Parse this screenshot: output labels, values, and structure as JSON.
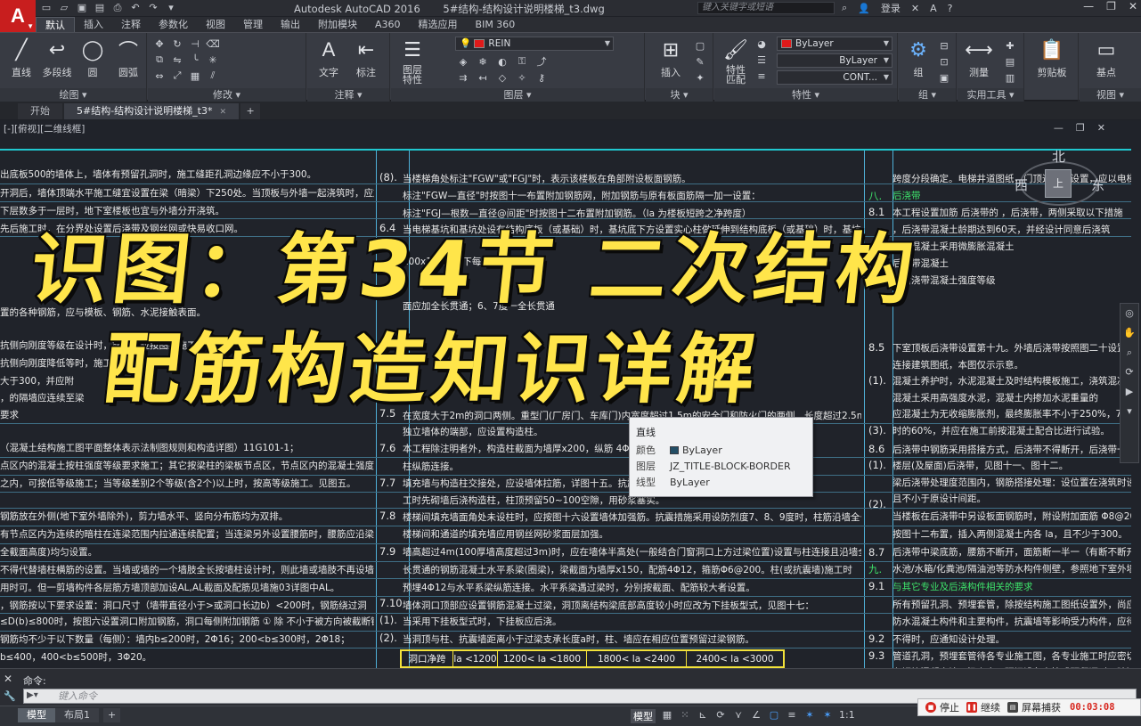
{
  "app": {
    "logo": "A",
    "product": "Autodesk AutoCAD 2016",
    "filename": "5#结构-结构设计说明楼梯_t3.dwg",
    "search_placeholder": "键入关键字或短语",
    "login": "登录"
  },
  "colors": {
    "accent": "#c81e1e",
    "headline": "#ffe54a",
    "cyan_border": "#20c7cf",
    "grid_line": "#4fb0d8",
    "green_text": "#3ee36b"
  },
  "ribbon_tabs": [
    "默认",
    "插入",
    "注释",
    "参数化",
    "视图",
    "管理",
    "输出",
    "附加模块",
    "A360",
    "精选应用",
    "BIM 360"
  ],
  "ribbon": {
    "draw": {
      "title": "绘图",
      "tools": [
        "直线",
        "多段线",
        "圆",
        "圆弧"
      ]
    },
    "modify": {
      "title": "修改"
    },
    "annotation": {
      "title": "注释",
      "tools": [
        "文字",
        "标注"
      ]
    },
    "layers": {
      "title": "图层",
      "layer_props": "图层\n特性",
      "current_layer": "REIN"
    },
    "block": {
      "title": "块",
      "insert": "插入"
    },
    "properties": {
      "title": "特性",
      "match": "特性\n匹配",
      "color": "ByLayer",
      "linetype": "ByLayer",
      "lineweight": "CONT..."
    },
    "groups": {
      "title": "组",
      "group": "组"
    },
    "utilities": {
      "title": "实用工具",
      "measure": "测量"
    },
    "clipboard": {
      "title": "剪贴板",
      "label": "剪贴板"
    },
    "view": {
      "title": "视图",
      "base": "基点"
    }
  },
  "file_tabs": [
    {
      "label": "开始",
      "active": false
    },
    {
      "label": "5#结构-结构设计说明楼梯_t3*",
      "active": true
    }
  ],
  "viewport": {
    "label": "[-][俯视][二维线框]",
    "viewcube": {
      "north": "北",
      "west": "西",
      "east": "东",
      "top": "上"
    }
  },
  "drawing": {
    "col1": [
      "出底板500的墙体上，墙体有预留孔洞时，施工缝距孔洞边缘应不小于300。",
      "开洞后，墙体顶端水平施工缝宜设置在梁（暗梁）下250处。当顶板与外墙一起浇筑时，应加强",
      "下层数多于一层时，地下室楼板也宜与外墙分开浇筑。",
      "先后施工时，在分界处设置后浇带及钢丝网或快易收口网。",
      "置的各种钢筋，应与模板、钢筋、水泥接触表面。",
      "抗侧向刚度等级在设计时，施工中应按图纸施工要求",
      "抗侧向刚度降低等时，施工时加强配筋",
      "大于300，并应附",
      "，的隔墙应连续至梁",
      "要求",
      "（混凝土结构施工图平面整体表示法制图规则和构造详图）11G101-1；",
      "点区内的混凝土按柱强度等级要求施工；其它按梁柱的梁板节点区，节点区内的混凝土强度等级",
      "之内，可按低等级施工；当等级差别2个等级(含2个)以上时，按高等级施工。见图五。",
      "钢筋放在外侧(地下室外墙除外)，剪力墙水平、竖向分布筋均为双排。",
      "有节点区内为连续的暗柱在连梁范围内拉通连续配置；当连梁另外设置腰筋时，腰筋应沿梁高(即",
      "全截面高度)均匀设置。",
      "不得代替墙柱横筋的设置。当墙或墙的一个墙肢全长按墙柱设计时，则此墙或墙肢不再设墙体",
      "用时可。但一剪墙构件各层筋方墙顶部加设AL,AL截面及配筋见墙施03详图中AL。",
      "，钢筋按以下要求设置：洞口尺寸（墙带直径小于>或洞口长边b）<200时，钢筋绕过洞",
      "≤D(b)≤800时，按图六设置洞口附加钢筋，洞口每侧附加钢筋  ① 除 不小于被方向被截断钢筋",
      "钢筋均不少于以下数量（每侧）：墙内b≤200时，2Φ16；200<b≤300时，2Φ18；",
      "b≤400，400<b≤500时，3Φ20。"
    ],
    "col2_nums": [
      "(8).",
      "6.4",
      "7.5",
      "7.6",
      "7.7",
      "7.8",
      "7.9",
      "7.10",
      "(1).",
      "(2)."
    ],
    "col2": [
      "当楼梯角处标注\"FGW\"或\"FGJ\"时，表示该楼板在角部附设板面钢筋。",
      "标注\"FGW—直径\"时按图十一布置附加钢筋网，附加钢筋与原有板面筋隔一加一设置：",
      "标注\"FGJ—根数—直径@间距\"时按图十二布置附加钢筋。（la 为楼板短跨之净跨度）",
      "当电梯基坑和基坑处设有结构底板（或基础）时，基坑底下方设置实心柱做延伸到结构底板（或基础）时，基坑",
      "100x100且住下每",
      "面应加全长贯通；6、7度一全长贯通",
      "在宽度大于2m的洞口两侧。重型门(厂房门、车库门)内宽度超过1.5m的安全门和防火门的两侧。长度超过2.5m的",
      "独立墙体的端部，应设置构造柱。",
      "本工程除注明者外，构造柱截面为墙厚x200，纵筋 4Φ10",
      "柱纵筋连接。",
      "填充墙与构造柱交接处，应设墙体拉筋，详图十五。抗震",
      "工时先砌墙后浇构造柱，柱顶预留50~100空隙，用砂浆塞实。",
      "楼梯间填充墙面角处未设柱时，应按图十六设置墙体加强筋。抗震措施采用设防烈度7、8、9度时，柱筋沿墙全长贯通。",
      "楼梯间和通道的填充墙应用钢丝网砂浆面层加强。",
      "墙高超过4m(100厚墙高度超过3m)时，应在墙体半高处(一般结合门窗洞口上方过梁位置)设置与柱连接且沿墙全",
      "长贯通的钢筋混凝土水平系梁(圈梁)，梁截面为墙厚x150，配筋4Φ12，箍筋Φ6@200。柱(或抗震墙)施工时",
      "预埋4Φ12与水平系梁纵筋连接。水平系梁遇过梁时，分别按截面、配筋较大者设置。",
      "墙体洞口顶部应设置钢筋混凝土过梁，洞顶离结构梁底部高度较小时应改为下挂板型式，见图十七：",
      "当采用下挂板型式时，下挂板应后浇。",
      "当洞顶与柱、抗震墙距离小于过梁支承长度a时，柱、墙应在相应位置预留过梁钢筋。"
    ],
    "col2_table": [
      "洞口净跨",
      "la <1200",
      "1200< la <1800",
      "1800< la <2400",
      "2400< la <3000"
    ],
    "col3_nums": [
      "八.",
      "8.1",
      "8.5",
      "(1).",
      "(3).",
      "8.6",
      "(1).",
      "(2).",
      "8.7",
      "九.",
      "9.1",
      "9.2",
      "9.3"
    ],
    "col3": [
      "跨度分段确定。电梯井道图纸，门顶过梁的设置，应以电梯厂家提",
      "后浇带",
      "本工程设置加筋  后浇带的  ，后浇带，两侧采取以下措施",
      "，后浇带混凝土龄期达到60天，并经设计同意后浇筑",
      "浇带混凝土采用微膨胀混凝土",
      "后浇带混凝土",
      "，后浇带混凝土强度等级",
      "下室顶板后浇带设置第十九。外墙后浇带按照图二十设置；本图后浇",
      "连接建筑图纸，本图仅示示意。",
      "混凝土养护时，水泥混凝土及时结构模板施工，浇筑混凝",
      "混凝土采用高强度水泥，混凝土内掺加水泥重量的",
      "应混凝土为无收缩膨胀剂，最终膨胀率不小于250%，7天的膨胀",
      "时的60%，并应在施工前按混凝土配合比进行试验。",
      "后浇带中钢筋采用搭接方式，后浇带不得断开，后浇带一侧一（有断不断开），按规定",
      "楼层(及屋面)后浇带，见图十一、图十二。",
      "梁后浇带处理度范围内，钢筋搭接处理：设位置在浇筑时设钢筋网片",
      "且不小于原设计间距。",
      "当楼板在后浇带中另设板面钢筋时，附设附加面筋 Φ8@200x200",
      "按图十二布置，插入两侧混凝土内各 la，且不少于300。",
      "后浇带中梁底筋，腰筋不断开，面筋断一半一（有断不断开）；",
      "水池/水箱/化粪池/隔油池等防水构件侧壁，参照地下室外墙",
      "与其它专业及后浇构件相关的要求",
      "所有预留孔洞、预埋套管，除按结构施工图纸设置外，尚应根据各",
      "防水混凝土构件和主要构件，抗震墙等影响受力构件，应待到试模段",
      "不得时，应通知设计处理。",
      "管道孔洞，预埋套管待各专业施工图，各专业施工时应密切配合",
      "在钢筋混凝土墙，梁上水平预埋设备套管或预留洞时，除注明者外"
    ]
  },
  "tooltip": {
    "title": "直线",
    "rows": [
      {
        "key": "颜色",
        "value": "ByLayer"
      },
      {
        "key": "图层",
        "value": "JZ_TITLE-BLOCK-BORDER"
      },
      {
        "key": "线型",
        "value": "ByLayer"
      }
    ]
  },
  "overlay": {
    "line1": "识图：第34节 二次结构",
    "line2": "配筋构造知识详解"
  },
  "command": {
    "history": "命令:",
    "placeholder": "键入命令"
  },
  "layout_tabs": [
    "模型",
    "布局1"
  ],
  "status": {
    "model": "模型",
    "scale": "1:1"
  },
  "recorder": {
    "stop": "停止",
    "resume": "继续",
    "capture": "屏幕捕获",
    "time": "00:03:08"
  }
}
